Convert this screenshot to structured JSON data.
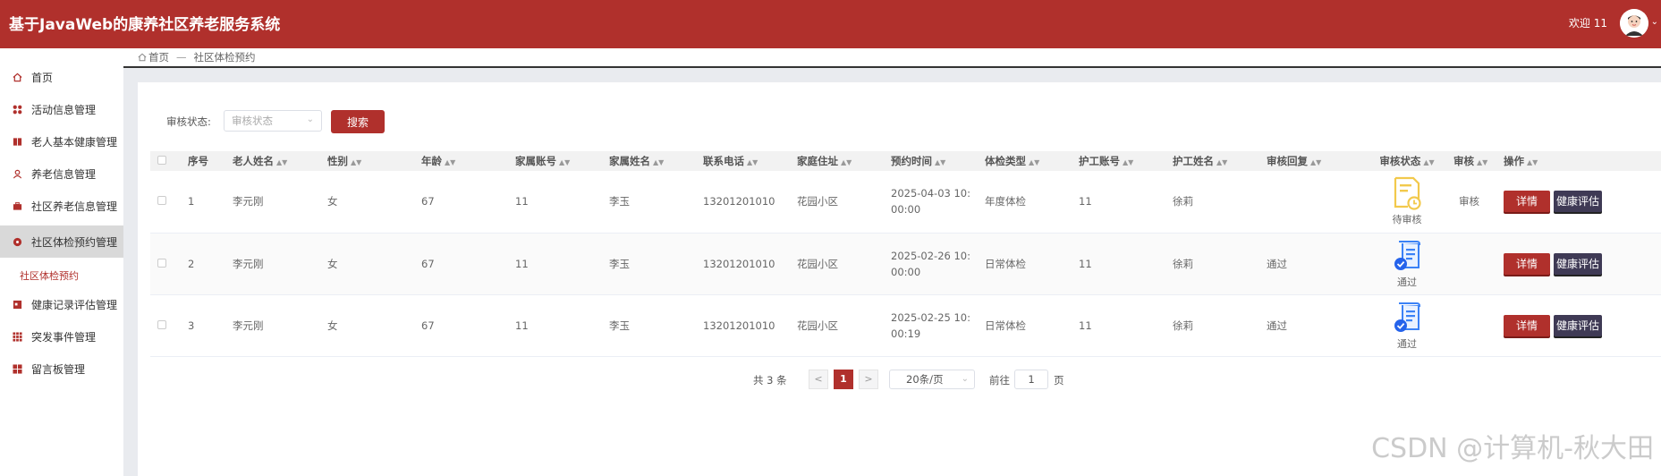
{
  "header": {
    "title": "基于JavaWeb的康养社区养老服务系统",
    "welcome": "欢迎 11"
  },
  "sidebar": {
    "items": [
      {
        "label": "首页",
        "icon": "home-icon"
      },
      {
        "label": "活动信息管理",
        "icon": "grid-icon"
      },
      {
        "label": "老人基本健康管理",
        "icon": "book-icon"
      },
      {
        "label": "养老信息管理",
        "icon": "user-icon"
      },
      {
        "label": "社区养老信息管理",
        "icon": "briefcase-icon"
      },
      {
        "label": "社区体检预约管理",
        "icon": "circle-icon"
      },
      {
        "label": "健康记录评估管理",
        "icon": "record-icon"
      },
      {
        "label": "突发事件管理",
        "icon": "apps-icon"
      },
      {
        "label": "留言板管理",
        "icon": "board-icon"
      }
    ],
    "sub_item": "社区体检预约"
  },
  "breadcrumb": {
    "home": "首页",
    "separator": "—",
    "current": "社区体检预约"
  },
  "filter": {
    "label": "审核状态:",
    "placeholder": "审核状态",
    "search_button": "搜索"
  },
  "table": {
    "headers": [
      "序号",
      "老人姓名",
      "性别",
      "年龄",
      "家属账号",
      "家属姓名",
      "联系电话",
      "家庭住址",
      "预约时间",
      "体检类型",
      "护工账号",
      "护工姓名",
      "审核回复",
      "审核状态",
      "审核",
      "操作"
    ],
    "rows": [
      {
        "no": "1",
        "name": "李元刚",
        "gender": "女",
        "age": "67",
        "family_account": "11",
        "family_name": "李玉",
        "phone": "13201201010",
        "address": "花园小区",
        "time_line1": "2025-04-03 10:",
        "time_line2": "00:00",
        "type": "年度体检",
        "nurse_account": "11",
        "nurse_name": "徐莉",
        "reply": "",
        "status": "待审核",
        "audit": "审核"
      },
      {
        "no": "2",
        "name": "李元刚",
        "gender": "女",
        "age": "67",
        "family_account": "11",
        "family_name": "李玉",
        "phone": "13201201010",
        "address": "花园小区",
        "time_line1": "2025-02-26 10:",
        "time_line2": "00:00",
        "type": "日常体检",
        "nurse_account": "11",
        "nurse_name": "徐莉",
        "reply": "通过",
        "status": "通过",
        "audit": ""
      },
      {
        "no": "3",
        "name": "李元刚",
        "gender": "女",
        "age": "67",
        "family_account": "11",
        "family_name": "李玉",
        "phone": "13201201010",
        "address": "花园小区",
        "time_line1": "2025-02-25 10:",
        "time_line2": "00:19",
        "type": "日常体检",
        "nurse_account": "11",
        "nurse_name": "徐莉",
        "reply": "通过",
        "status": "通过",
        "audit": ""
      }
    ],
    "detail_button": "详情",
    "eval_button": "健康评估"
  },
  "pagination": {
    "total": "共 3 条",
    "prev": "<",
    "current": "1",
    "next": ">",
    "page_size": "20条/页",
    "goto": "前往",
    "goto_value": "1",
    "page_unit": "页"
  },
  "watermark": "CSDN @计算机-秋大田",
  "colors": {
    "primary": "#b0302c",
    "eval_button": "#3f3a55",
    "pending_icon": "#f2c94c",
    "approved_icon": "#3b82f6"
  }
}
